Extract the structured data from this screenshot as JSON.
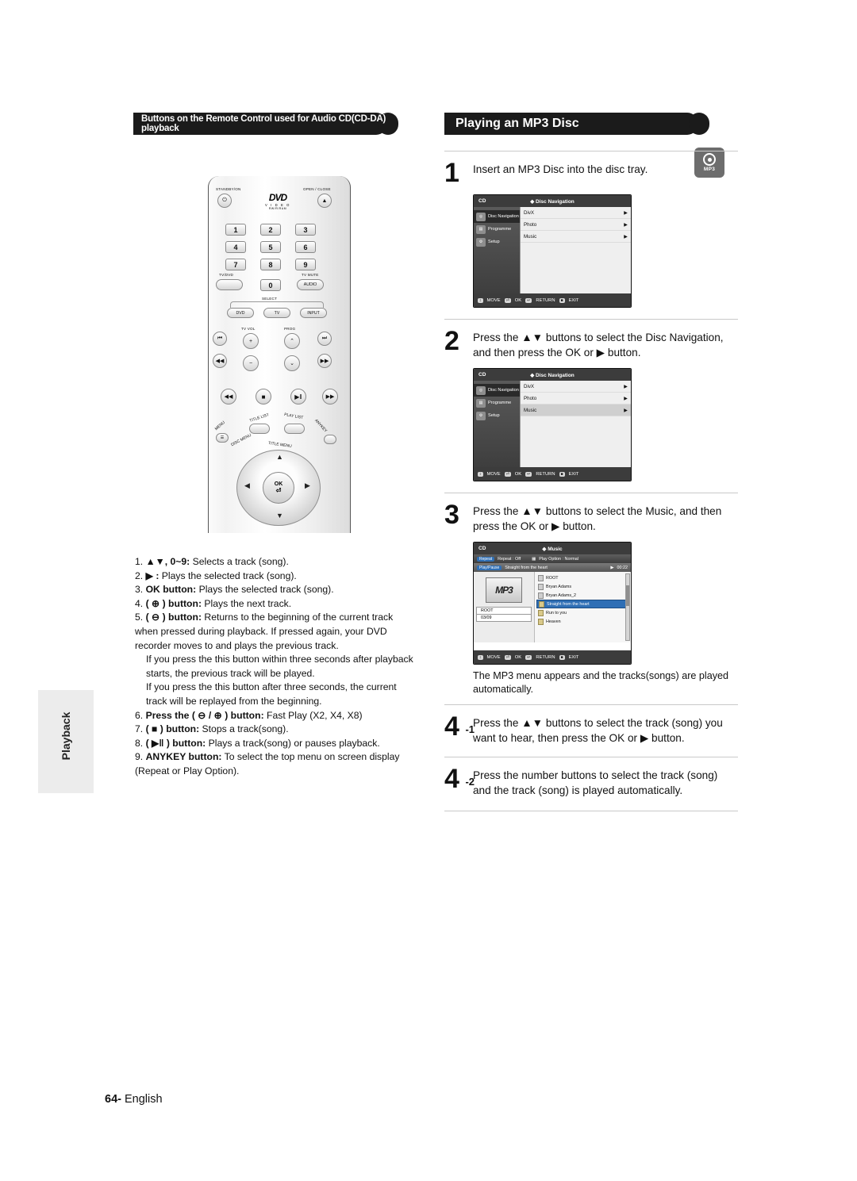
{
  "headers": {
    "left": "Buttons on the Remote Control used for Audio CD(CD-DA) playback",
    "right": "Playing an MP3 Disc"
  },
  "side_tab": "Playback",
  "badge": {
    "label": "MP3"
  },
  "remote": {
    "labels": {
      "standby": "STANDBY/ON",
      "open_close": "OPEN / CLOSE",
      "tvdvd": "TV/DVD",
      "tv_mute": "TV MUTE",
      "audio": "AUDIO",
      "select": "SELECT",
      "dvd": "DVD",
      "tv": "TV",
      "input": "INPUT",
      "tv_vol": "TV VOL",
      "prog": "PROG",
      "title_list": "TITLE LIST",
      "play_list": "PLAY LIST",
      "menu": "MENU",
      "disc_menu": "DISC MENU",
      "title_menu": "TITLE MENU",
      "anykey": "ANYKEY",
      "ok": "OK",
      "dvd_logo": "DVD",
      "video": "V I D E O",
      "video_sub": "RW/R/RAM"
    },
    "numbers": [
      "1",
      "2",
      "3",
      "4",
      "5",
      "6",
      "7",
      "8",
      "9",
      "0"
    ]
  },
  "left_list": [
    {
      "n": "1.",
      "bold": "▲▼, 0~9:",
      "text": " Selects a track (song)."
    },
    {
      "n": "2.",
      "bold": "▶ :",
      "text": " Plays the selected track (song)."
    },
    {
      "n": "3.",
      "bold": "OK button:",
      "text": " Plays the selected track (song)."
    },
    {
      "n": "4.",
      "bold": "( ⊕ ) button:",
      "text": " Plays the next track."
    },
    {
      "n": "5.",
      "bold": "( ⊖ ) button:",
      "text": " Returns to the beginning of the current track when pressed during playback. If pressed again, your DVD recorder moves to and plays the previous track."
    },
    {
      "n": "",
      "bold": "",
      "text": "If you press the this button within three seconds after playback starts, the previous track will be played."
    },
    {
      "n": "",
      "bold": "",
      "text": "If you press the this button after three seconds, the current track will be replayed from the beginning."
    },
    {
      "n": "6.",
      "bold": "Press the ( ⊖ / ⊕ ) button:",
      "text": " Fast Play (X2, X4, X8)"
    },
    {
      "n": "7.",
      "bold": "( ■ ) button:",
      "text": " Stops a track(song)."
    },
    {
      "n": "8.",
      "bold": "( ▶‖ ) button:",
      "text": " Plays a track(song) or pauses playback."
    },
    {
      "n": "9.",
      "bold": "ANYKEY button:",
      "text": " To select the top menu on screen display (Repeat or Play Option)."
    }
  ],
  "steps": [
    {
      "num": "1",
      "sup": "",
      "text": "Insert an MP3 Disc into the disc tray."
    },
    {
      "num": "2",
      "sup": "",
      "text": "Press the ▲▼ buttons to select the Disc Navigation, and then press the OK or ▶ button."
    },
    {
      "num": "3",
      "sup": "",
      "text": "Press the ▲▼ buttons to select the Music, and then press the OK or ▶ button."
    },
    {
      "num": "4",
      "sup": "-1",
      "text": "Press the ▲▼ buttons to select the track (song) you want to hear, then press the OK or ▶ button."
    },
    {
      "num": "4",
      "sup": "-2",
      "text": "Press the number buttons to select the track (song) and the track (song) is played automatically."
    }
  ],
  "note": "The MP3 menu appears and the tracks(songs) are played automatically.",
  "osd1": {
    "disc": "CD",
    "title": "Disc Navigation",
    "left_items": [
      {
        "label": "Disc Navigation",
        "selected": true
      },
      {
        "label": "Programme",
        "selected": false
      },
      {
        "label": "Setup",
        "selected": false
      }
    ],
    "right_items": [
      {
        "label": "DivX",
        "selected": false
      },
      {
        "label": "Photo",
        "selected": false
      },
      {
        "label": "Music",
        "selected": false
      }
    ],
    "footer": [
      {
        "key": "↕",
        "label": "MOVE"
      },
      {
        "key": "⏎",
        "label": "OK"
      },
      {
        "key": "↩",
        "label": "RETURN"
      },
      {
        "key": "■",
        "label": "EXIT"
      }
    ]
  },
  "osd2": {
    "disc": "CD",
    "title": "Disc Navigation",
    "left_items": [
      {
        "label": "Disc Navigation",
        "selected": true
      },
      {
        "label": "Programme",
        "selected": false
      },
      {
        "label": "Setup",
        "selected": false
      }
    ],
    "right_items": [
      {
        "label": "DivX",
        "selected": false
      },
      {
        "label": "Photo",
        "selected": false
      },
      {
        "label": "Music",
        "selected": true
      }
    ],
    "footer": [
      {
        "key": "↕",
        "label": "MOVE"
      },
      {
        "key": "⏎",
        "label": "OK"
      },
      {
        "key": "↩",
        "label": "RETURN"
      },
      {
        "key": "■",
        "label": "EXIT"
      }
    ]
  },
  "osd3": {
    "disc": "CD",
    "title": "Music",
    "repeat_tag": "Repeat",
    "repeat_value": "Repeat : Off",
    "play_option": "Play Option : Normal",
    "now_tag": "Play/Pause",
    "now_playing": "Straight from the heart",
    "time": "00:22",
    "art_text": "MP3",
    "root_label": "ROOT",
    "counter": "03/09",
    "tracks": [
      {
        "label": "ROOT",
        "type": "folder",
        "selected": false
      },
      {
        "label": "Bryan Adams",
        "type": "folder",
        "selected": false
      },
      {
        "label": "Bryan Adams_2",
        "type": "folder",
        "selected": false
      },
      {
        "label": "Straight from the heart",
        "type": "file",
        "selected": true
      },
      {
        "label": "Run to you",
        "type": "file",
        "selected": false
      },
      {
        "label": "Heaven",
        "type": "file",
        "selected": false
      }
    ],
    "footer": [
      {
        "key": "↕",
        "label": "MOVE"
      },
      {
        "key": "⏎",
        "label": "OK"
      },
      {
        "key": "↩",
        "label": "RETURN"
      },
      {
        "key": "■",
        "label": "EXIT"
      }
    ]
  },
  "page": {
    "number": "64-",
    "language": "English"
  }
}
